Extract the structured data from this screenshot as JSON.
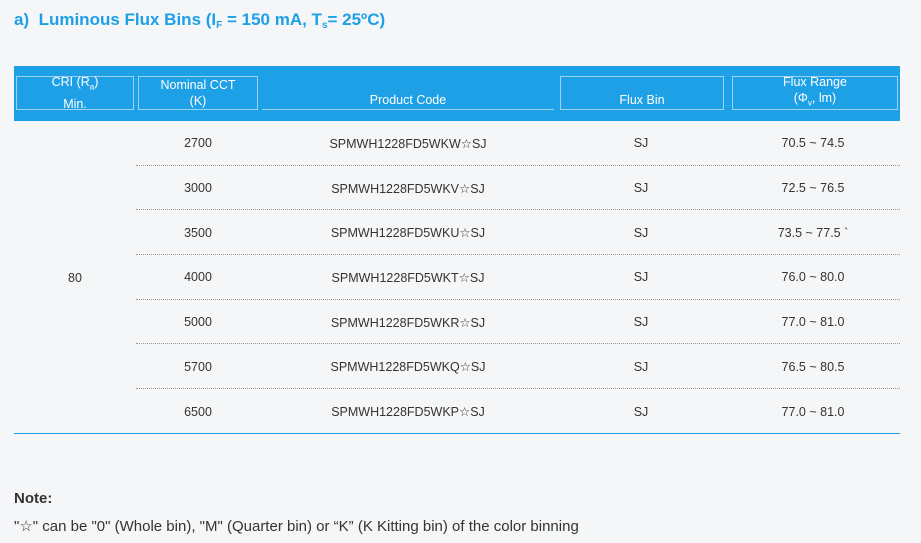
{
  "heading": {
    "prefix": "a)",
    "title": "Luminous Flux Bins (I",
    "sub_f": "F",
    "mid": " = 150 mA, T",
    "sub_s": "s",
    "suffix": "= 25ºC)"
  },
  "table": {
    "headers": {
      "cri_line1": "CRI (R",
      "cri_sub": "a",
      "cri_close": ")",
      "cri_line2": "Min.",
      "cct_line1": "Nominal CCT",
      "cct_line2": "(K)",
      "product_code": "Product Code",
      "flux_bin": "Flux Bin",
      "flux_range_line1": "Flux Range",
      "flux_range_line2": "(Φ",
      "flux_range_sub": "v",
      "flux_range_unit": ", lm)"
    },
    "cri_value": "80",
    "rows": [
      {
        "cct": "2700",
        "code": "SPMWH1228FD5WKW☆SJ",
        "bin": "SJ",
        "range": "70.5 ~ 74.5"
      },
      {
        "cct": "3000",
        "code": "SPMWH1228FD5WKV☆SJ",
        "bin": "SJ",
        "range": "72.5 ~ 76.5"
      },
      {
        "cct": "3500",
        "code": "SPMWH1228FD5WKU☆SJ",
        "bin": "SJ",
        "range": "73.5 ~ 77.5 `"
      },
      {
        "cct": "4000",
        "code": "SPMWH1228FD5WKT☆SJ",
        "bin": "SJ",
        "range": "76.0 ~ 80.0"
      },
      {
        "cct": "5000",
        "code": "SPMWH1228FD5WKR☆SJ",
        "bin": "SJ",
        "range": "77.0 ~ 81.0"
      },
      {
        "cct": "5700",
        "code": "SPMWH1228FD5WKQ☆SJ",
        "bin": "SJ",
        "range": "76.5 ~ 80.5"
      },
      {
        "cct": "6500",
        "code": "SPMWH1228FD5WKP☆SJ",
        "bin": "SJ",
        "range": "77.0 ~ 81.0"
      }
    ]
  },
  "note": {
    "title": "Note:",
    "text": "\"☆\" can be \"0\" (Whole bin), \"M\" (Quarter bin) or “K” (K Kitting bin) of the color binning"
  },
  "colors": {
    "accent": "#1ea0e6",
    "background": "#f4f6f8"
  }
}
